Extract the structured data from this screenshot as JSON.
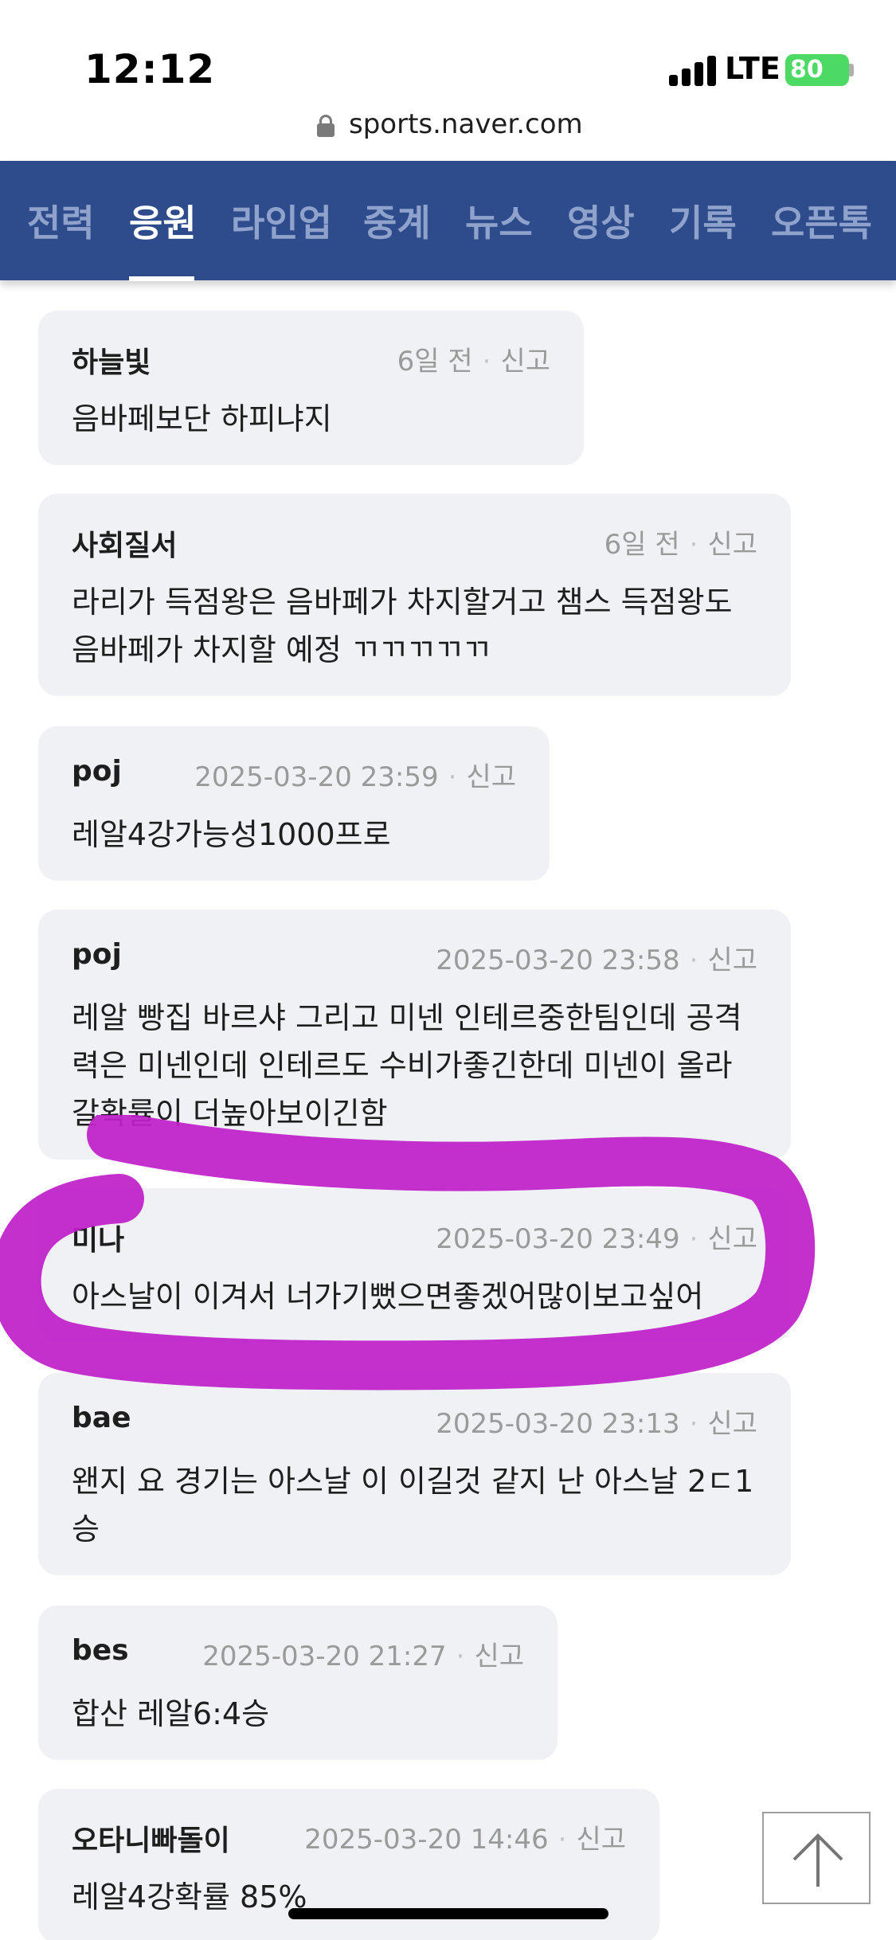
{
  "status_bar": {
    "time": "12:12",
    "network": "LTE",
    "battery": "80",
    "url": "sports.naver.com"
  },
  "tabs": [
    {
      "label": "전력"
    },
    {
      "label": "응원"
    },
    {
      "label": "라인업"
    },
    {
      "label": "중계"
    },
    {
      "label": "뉴스"
    },
    {
      "label": "영상"
    },
    {
      "label": "기록"
    },
    {
      "label": "오픈톡"
    }
  ],
  "active_tab": "응원",
  "report_label": "신고",
  "comments": [
    {
      "author": "하늘빛",
      "time": "6일 전",
      "text": "음바페보단 하피냐지"
    },
    {
      "author": "사회질서",
      "time": "6일 전",
      "text": "라리가 득점왕은 음바페가 차지할거고 챔스 득점왕도 음바페가 차지할 예정 ㄲㄲㄲㄲㄲ"
    },
    {
      "author": "poj",
      "time": "2025-03-20 23:59",
      "text": "레알4강가능성1000프로"
    },
    {
      "author": "poj",
      "time": "2025-03-20 23:58",
      "text": "레알 빵집 바르샤 그리고 미넨 인테르중한팀인데 공격력은 미넨인데 인테르도 수비가좋긴한데 미넨이 올라갈확률이 더높아보이긴함"
    },
    {
      "author": "미나",
      "time": "2025-03-20 23:49",
      "text": "아스날이 이겨서 너가기뻤으면좋겠어많이보고싶어"
    },
    {
      "author": "bae",
      "time": "2025-03-20 23:13",
      "text": "왠지 요 경기는 아스날 이 이길것 같지 난 아스날 2ㄷ1 승"
    },
    {
      "author": "bes",
      "time": "2025-03-20 21:27",
      "text": "합산 레알6:4승"
    },
    {
      "author": "오타니빠돌이",
      "time": "2025-03-20 14:46",
      "text": "레알4강확률 85%"
    }
  ],
  "colors": {
    "nav_bg": "#2e4c8c",
    "card_bg": "#f0f1f4",
    "highlight": "#c020c8",
    "battery": "#4cd964"
  },
  "icons": {
    "lock": "lock-icon",
    "scroll_top": "arrow-up-icon"
  }
}
